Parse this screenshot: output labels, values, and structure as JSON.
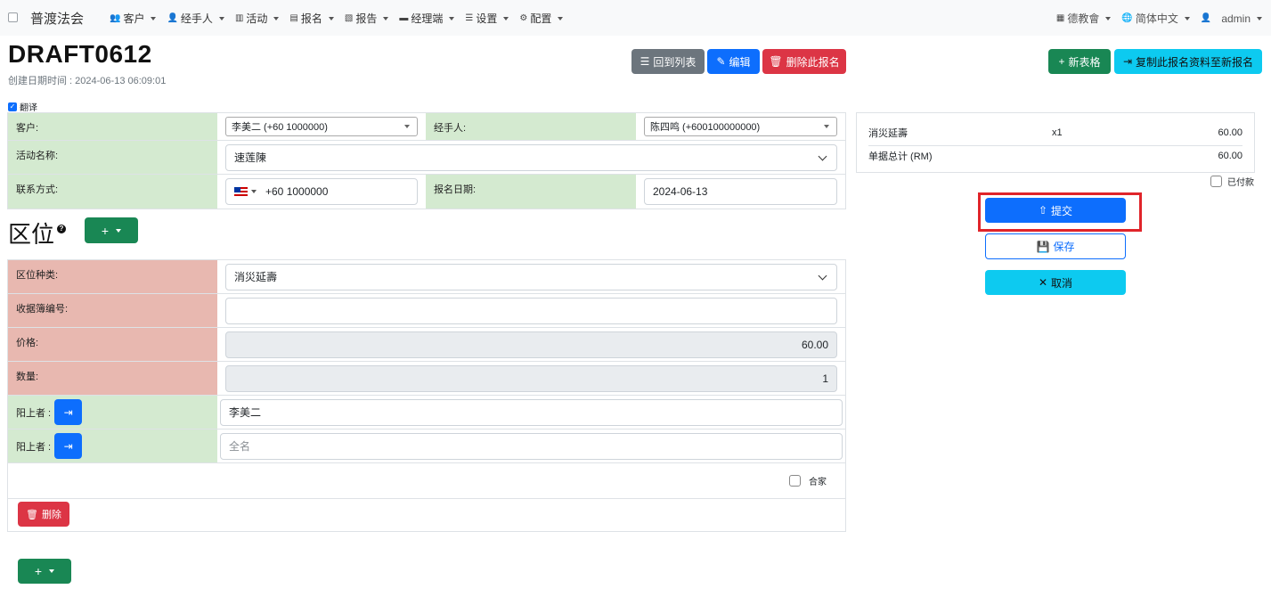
{
  "navbar": {
    "brand": "普渡法会",
    "items": [
      {
        "label": "客户",
        "icon": "users-icon"
      },
      {
        "label": "经手人",
        "icon": "user-tie-icon"
      },
      {
        "label": "活动",
        "icon": "map-icon"
      },
      {
        "label": "报名",
        "icon": "file-icon"
      },
      {
        "label": "报告",
        "icon": "file-export-icon"
      },
      {
        "label": "经理端",
        "icon": "briefcase-icon"
      },
      {
        "label": "设置",
        "icon": "sliders-icon"
      },
      {
        "label": "配置",
        "icon": "gear-icon"
      }
    ],
    "right": {
      "org": "德教會",
      "language": "简体中文",
      "user": "admin"
    }
  },
  "page": {
    "title": "DRAFT0612",
    "created": "创建日期时间 : 2024-06-13 06:09:01",
    "buttons": {
      "back": "回到列表",
      "edit": "编辑",
      "delete_registration": "删除此报名",
      "new_form": "新表格",
      "copy": "复制此报名资料至新报名"
    },
    "translate_label": "翻译"
  },
  "form": {
    "customer_label": "客户:",
    "customer_value": "李美二 (+60 1000000)",
    "handler_label": "经手人:",
    "handler_value": "陈四鸣 (+600100000000)",
    "activity_label": "活动名称:",
    "activity_value": "速莲陳",
    "contact_label": "联系方式:",
    "contact_value": "+60 1000000",
    "reg_date_label": "报名日期:",
    "reg_date_value": "2024-06-13"
  },
  "section": {
    "title": "区位",
    "add_button": "+",
    "slot_type_label": "区位种类:",
    "slot_type_value": "消災延壽",
    "receipt_label": "收据簿编号:",
    "receipt_value": "",
    "price_label": "价格:",
    "price_value": "60.00",
    "qty_label": "数量:",
    "qty_value": "1",
    "yang1_label": "阳上者 :",
    "yang1_value": "李美二",
    "yang2_label": "阳上者 :",
    "yang2_placeholder": "全名",
    "family_label": "合家",
    "delete_button": "删除"
  },
  "summary": {
    "item_name": "消災延壽",
    "item_qty": "x1",
    "item_amount": "60.00",
    "total_label": "单据总计 (RM)",
    "total_amount": "60.00",
    "paid_label": "已付款"
  },
  "actions": {
    "submit": "提交",
    "save": "保存",
    "cancel": "取消"
  },
  "bottom_add": "+"
}
